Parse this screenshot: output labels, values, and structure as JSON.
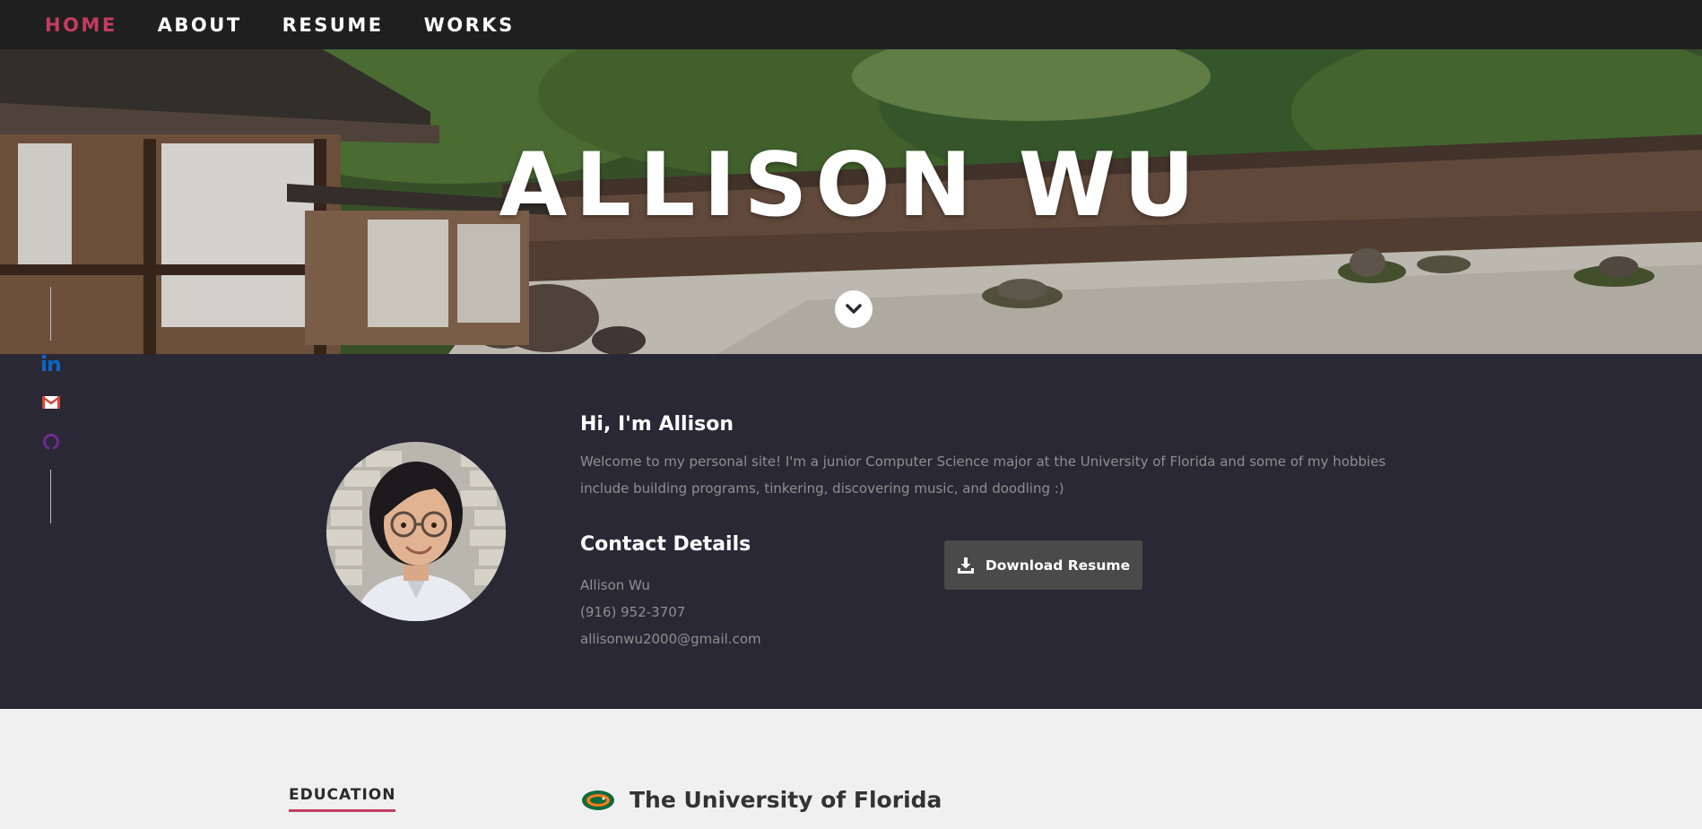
{
  "nav": {
    "items": [
      {
        "label": "HOME",
        "active": true
      },
      {
        "label": "ABOUT",
        "active": false
      },
      {
        "label": "RESUME",
        "active": false
      },
      {
        "label": "WORKS",
        "active": false
      }
    ]
  },
  "hero": {
    "title": "ALLISON WU",
    "scroll_icon": "chevron-down-icon"
  },
  "social": {
    "icons": [
      "linkedin-icon",
      "gmail-icon",
      "github-icon"
    ]
  },
  "about": {
    "heading": "Hi, I'm Allison",
    "paragraph": "Welcome to my personal site! I'm a junior Computer Science major at the University of Florida and some of my hobbies include building programs, tinkering, discovering music, and doodling :)",
    "contact_heading": "Contact Details",
    "contact": {
      "name": "Allison Wu",
      "phone": "(916) 952-3707",
      "email": "allisonwu2000@gmail.com"
    },
    "download_label": "Download Resume",
    "download_icon": "download-icon"
  },
  "resume": {
    "section_label": "EDUCATION",
    "school_name": "The University of Florida",
    "school_logo": "gator-logo-icon"
  },
  "colors": {
    "accent": "#c43c62",
    "nav_bg": "#1f1f1f",
    "about_bg": "#2a2835",
    "resume_bg": "#f0f0f0",
    "button_bg": "#4a4a4a",
    "linkedin": "#0a66c2",
    "gmail": "#d44638",
    "github": "#6e2b8f"
  }
}
